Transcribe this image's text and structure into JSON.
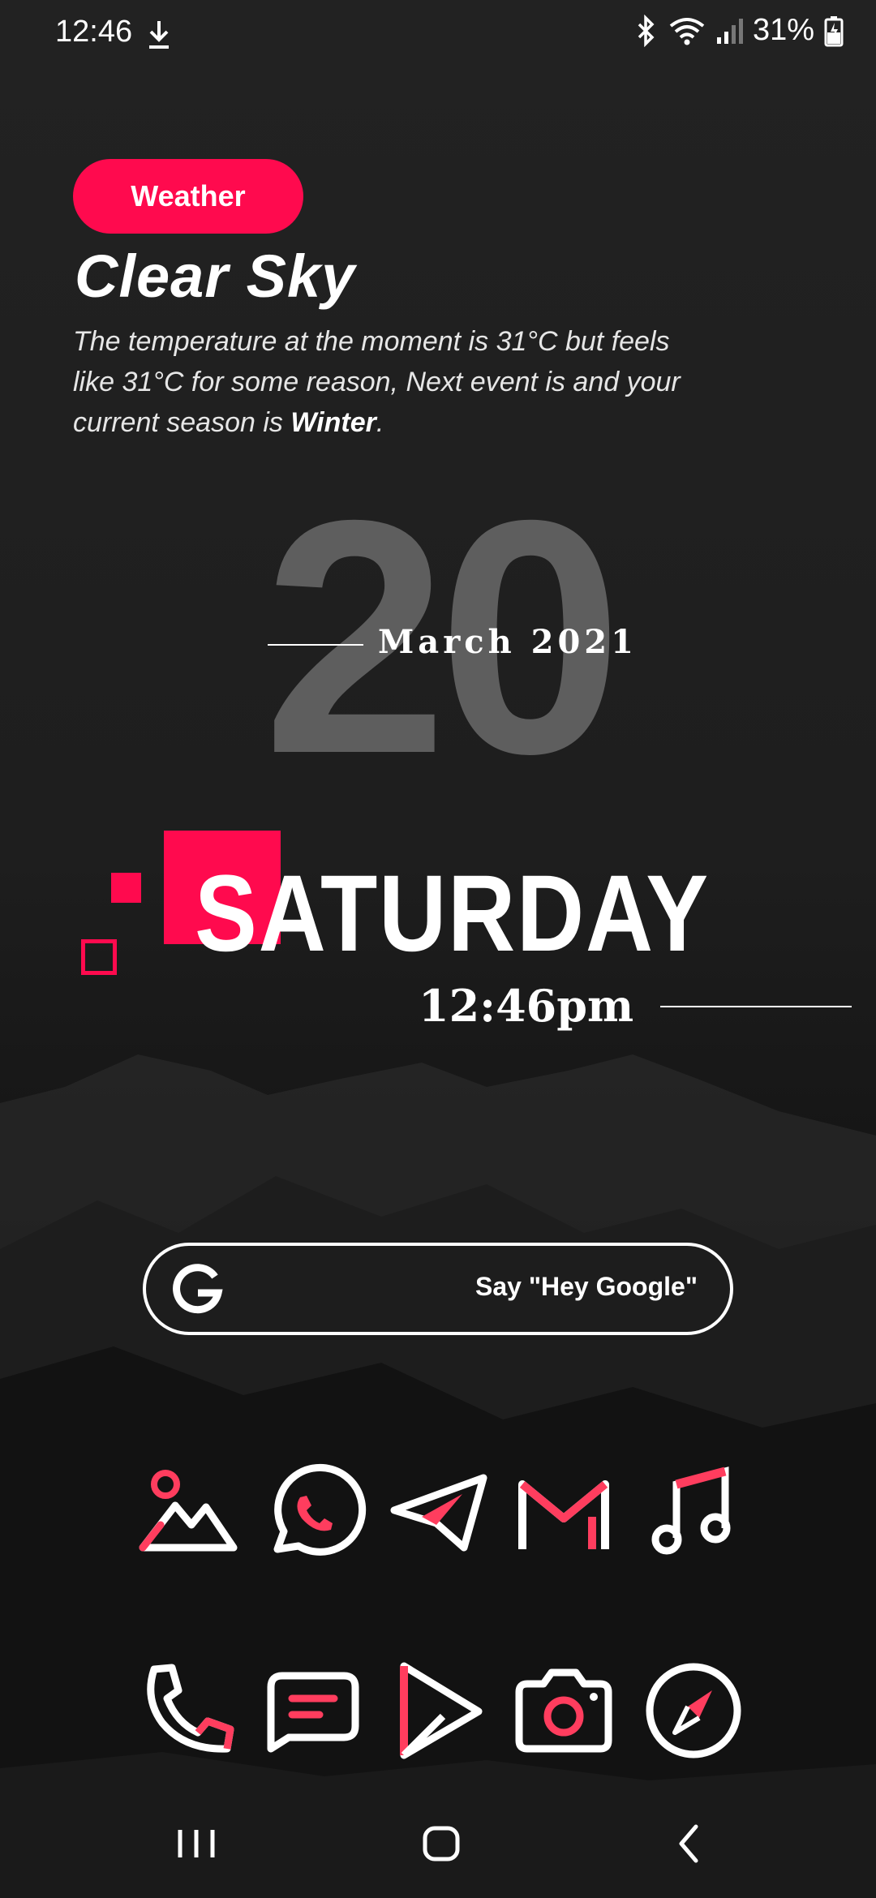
{
  "status_bar": {
    "time": "12:46",
    "battery_percent": "31%",
    "icons": [
      "download-icon",
      "bluetooth-icon",
      "wifi-icon",
      "signal-icon",
      "battery-charging-icon"
    ]
  },
  "weather": {
    "badge": "Weather",
    "title": "Clear Sky",
    "desc_part1": "The temperature at the moment is 31°C but feels like 31°C for some reason, Next event is  and your current season is ",
    "season": "Winter",
    "desc_end": "."
  },
  "date": {
    "day_number": "20",
    "month_year": "March 2021",
    "weekday": "SATURDAY",
    "time": "12:46pm"
  },
  "search": {
    "logo": "G",
    "hint": "Say \"Hey Google\""
  },
  "dock": {
    "row1": [
      "gallery-icon",
      "whatsapp-icon",
      "telegram-icon",
      "gmail-icon",
      "music-icon"
    ],
    "row2": [
      "phone-icon",
      "messages-icon",
      "play-store-icon",
      "camera-icon",
      "browser-compass-icon"
    ]
  },
  "nav": [
    "recents-button",
    "home-button",
    "back-button"
  ],
  "colors": {
    "accent": "#ff0a4e",
    "icon_outline": "#ffffff",
    "big_day": "#5e5e5e",
    "background": "#1c1c1c"
  }
}
